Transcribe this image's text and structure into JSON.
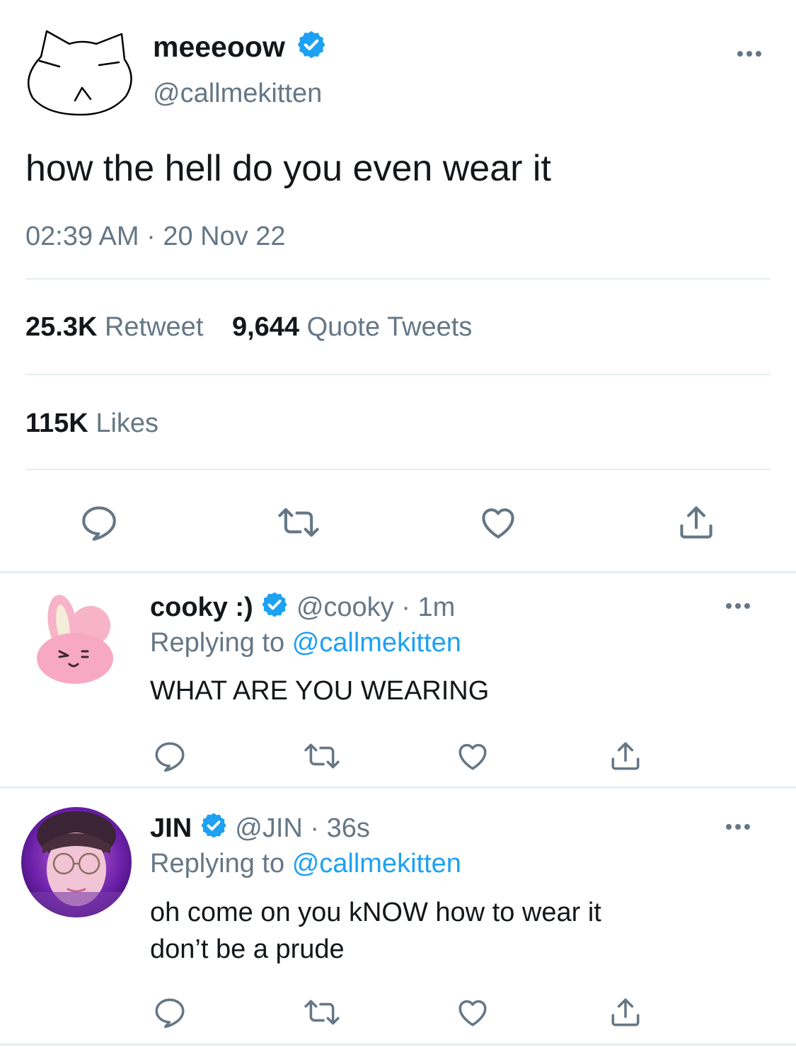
{
  "main_tweet": {
    "display_name": "meeeoow",
    "handle": "@callmekitten",
    "text": "how the hell do you even wear it",
    "time": "02:39 AM",
    "date": "20 Nov 22",
    "separator": "·",
    "retweets_count": "25.3K",
    "retweets_label": "Retweet",
    "quotes_count": "9,644",
    "quotes_label": "Quote Tweets",
    "likes_count": "115K",
    "likes_label": "Likes"
  },
  "replies": [
    {
      "display_name": "cooky :)",
      "handle": "@cooky",
      "separator": "·",
      "time_ago": "1m",
      "replying_label": "Replying to",
      "replying_handle": "@callmekitten",
      "text_line1": "WHAT ARE YOU WEARING",
      "text_line2": ""
    },
    {
      "display_name": "JIN",
      "handle": "@JIN",
      "separator": "·",
      "time_ago": "36s",
      "replying_label": "Replying to",
      "replying_handle": "@callmekitten",
      "text_line1": "oh come on you kNOW how to wear it",
      "text_line2": "don’t be a prude"
    }
  ],
  "icons": {
    "verified": "verified-badge-icon",
    "reply": "reply-icon",
    "retweet": "retweet-icon",
    "like": "heart-icon",
    "share": "share-icon",
    "more": "more-icon"
  },
  "colors": {
    "accent": "#1da1f2",
    "muted": "#657786",
    "text": "#14171a",
    "divider": "#e6ecf0"
  }
}
